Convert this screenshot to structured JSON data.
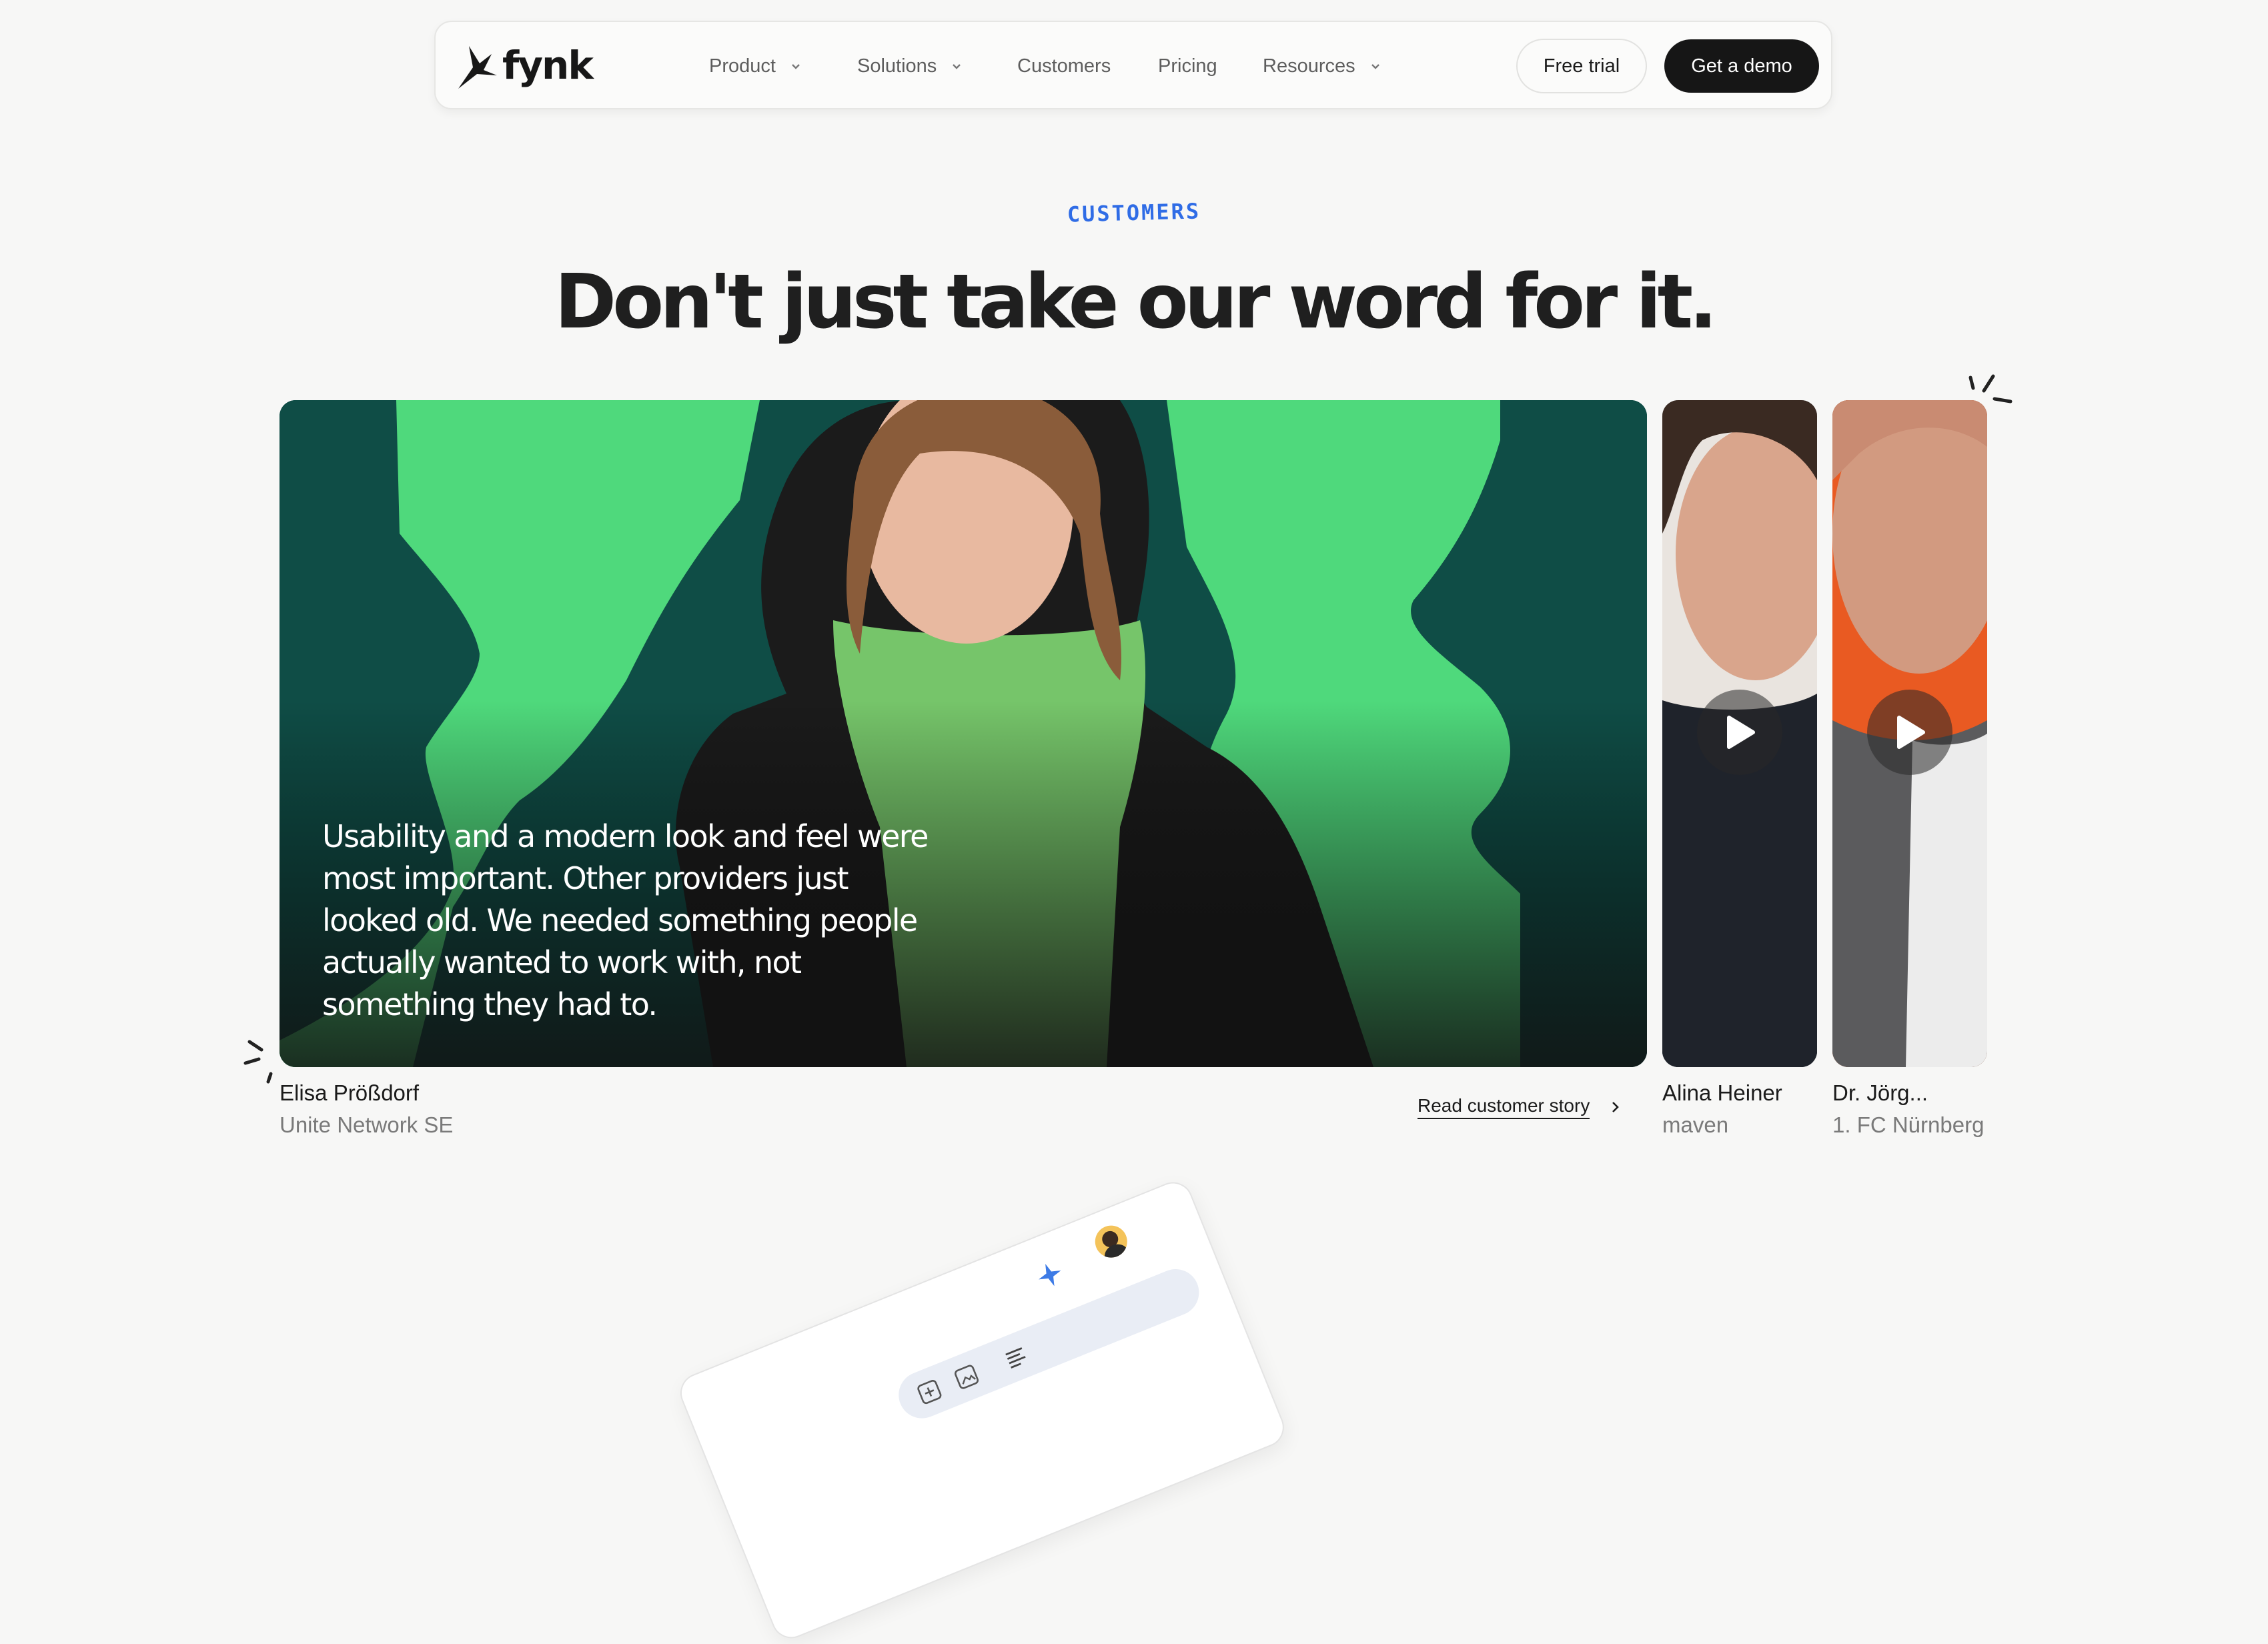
{
  "nav": {
    "logo_text": "fynk",
    "items": [
      {
        "label": "Product",
        "has_dropdown": true
      },
      {
        "label": "Solutions",
        "has_dropdown": true
      },
      {
        "label": "Customers",
        "has_dropdown": false
      },
      {
        "label": "Pricing",
        "has_dropdown": false
      },
      {
        "label": "Resources",
        "has_dropdown": true
      }
    ],
    "free_trial_label": "Free trial",
    "demo_label": "Get a demo"
  },
  "hero": {
    "eyebrow": "CUSTOMERS",
    "headline": "Don't just take our word for it."
  },
  "testimonials": [
    {
      "quote": "Usability and a modern look and feel were most important. Other providers just looked old. We needed something people actually wanted to work with, not something they had to.",
      "name": "Elisa Prößdorf",
      "company": "Unite Network SE",
      "link_label": "Read customer story"
    },
    {
      "name": "Alina Heiner",
      "company": "maven"
    },
    {
      "name": "Dr. Jörg...",
      "company": "1. FC Nürnberg"
    }
  ],
  "colors": {
    "brand_green": "#4fd97c",
    "card_teal": "#0e4a44",
    "accent_blue": "#2f6ce6",
    "dark_button": "#161616"
  },
  "icons": [
    "logo-bird-icon",
    "chevron-down-icon",
    "play-icon",
    "chevron-right-icon",
    "sparkle-icon",
    "avatar"
  ]
}
